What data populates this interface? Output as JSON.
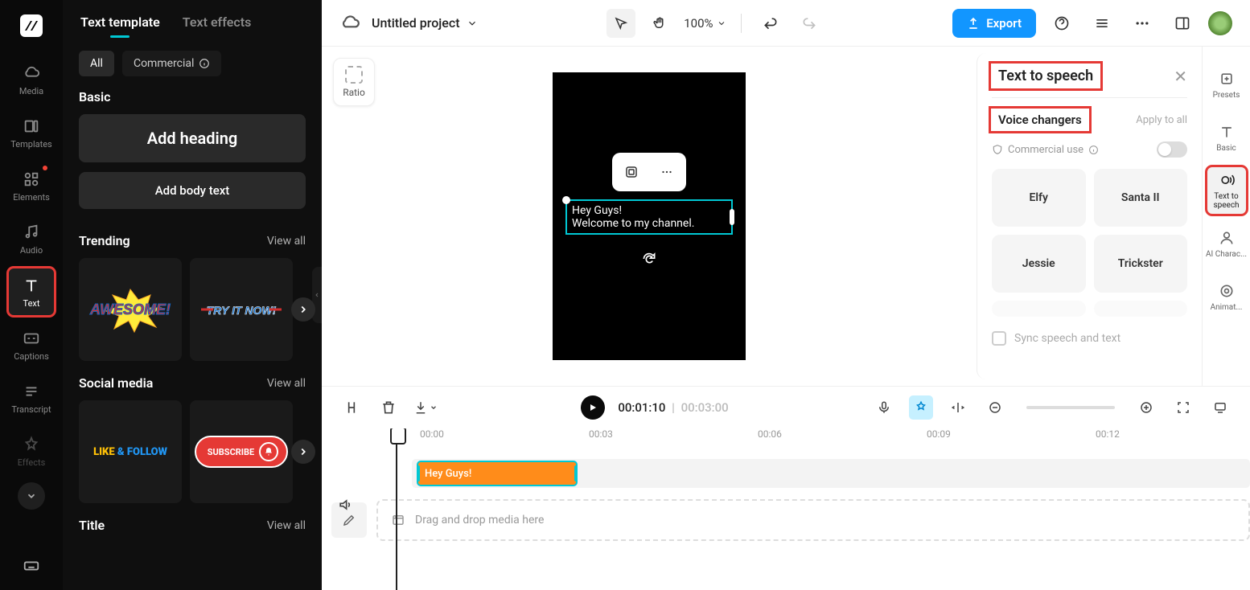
{
  "far_left_nav": {
    "items": [
      {
        "icon": "media",
        "label": "Media"
      },
      {
        "icon": "templates",
        "label": "Templates"
      },
      {
        "icon": "elements",
        "label": "Elements",
        "dot": true
      },
      {
        "icon": "audio",
        "label": "Audio"
      },
      {
        "icon": "text",
        "label": "Text",
        "active": true,
        "highlighted": true
      },
      {
        "icon": "captions",
        "label": "Captions"
      },
      {
        "icon": "transcript",
        "label": "Transcript"
      },
      {
        "icon": "effects",
        "label": "Effects"
      }
    ]
  },
  "left_panel": {
    "tabs": {
      "template": "Text template",
      "effects": "Text effects"
    },
    "filters": {
      "all": "All",
      "commercial": "Commercial"
    },
    "basic": {
      "title": "Basic",
      "add_heading": "Add heading",
      "add_body": "Add body text"
    },
    "trending": {
      "title": "Trending",
      "view_all": "View all",
      "items": [
        "AWESOME!",
        "TRY IT NOW!"
      ]
    },
    "social": {
      "title": "Social media",
      "view_all": "View all",
      "like_follow_1": "LIKE",
      "like_follow_2": " & FOLLOW",
      "subscribe": "SUBSCRIBE"
    },
    "title_section": {
      "title": "Title",
      "view_all": "View all"
    }
  },
  "top_bar": {
    "project_title": "Untitled project",
    "zoom": "100%",
    "export": "Export"
  },
  "canvas": {
    "ratio_label": "Ratio",
    "text_line1": "Hey Guys!",
    "text_line2": "Welcome to my channel."
  },
  "tts_panel": {
    "title": "Text to speech",
    "subtitle": "Voice changers",
    "apply_all": "Apply to all",
    "commercial": "Commercial use",
    "voices": [
      "Elfy",
      "Santa II",
      "Jessie",
      "Trickster"
    ],
    "sync": "Sync speech and text"
  },
  "far_right_nav": {
    "items": [
      {
        "label": "Presets"
      },
      {
        "label": "Basic"
      },
      {
        "label": "Text to speech",
        "active": true,
        "highlighted": true
      },
      {
        "label": "AI Charac..."
      },
      {
        "label": "Animat..."
      }
    ]
  },
  "timeline": {
    "current": "00:01:10",
    "total": "00:03:00",
    "marks": [
      "00:00",
      "00:03",
      "00:06",
      "00:09",
      "00:12"
    ],
    "clip_label": "Hey Guys!",
    "drop_hint": "Drag and drop media here"
  }
}
